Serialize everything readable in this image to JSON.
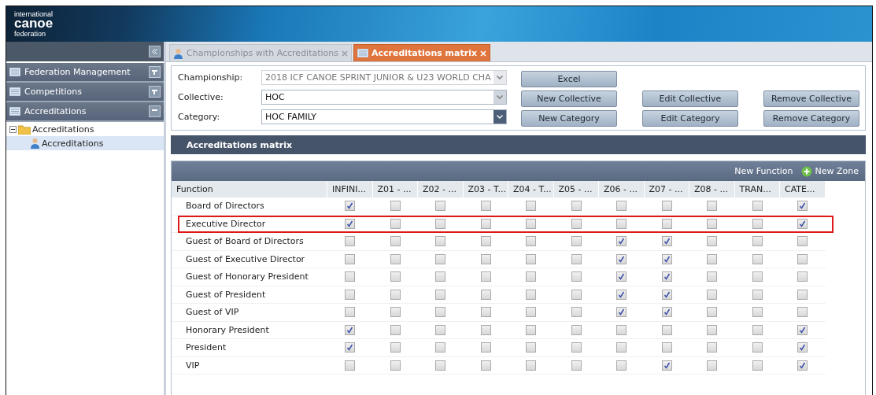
{
  "logo": [
    "international",
    "canoe",
    "federation"
  ],
  "sidebar": {
    "sections": [
      {
        "label": "Federation Management",
        "expanded": false
      },
      {
        "label": "Competitions",
        "expanded": false
      },
      {
        "label": "Accreditations",
        "expanded": true
      }
    ],
    "tree": [
      {
        "label": "Accreditations",
        "expanded": true,
        "selected": false,
        "children": [
          {
            "label": "Accreditations",
            "selected": true
          }
        ]
      }
    ]
  },
  "tabs": [
    {
      "label": "Championships with Accreditations",
      "selected": false
    },
    {
      "label": "Accreditations matrix",
      "selected": true
    }
  ],
  "form": {
    "fields": [
      {
        "label": "Championship:",
        "value": "2018 ICF CANOE SPRINT JUNIOR & U23 WORLD CHA",
        "disabled": true,
        "focused": false
      },
      {
        "label": "Collective:",
        "value": "HOC",
        "disabled": false,
        "focused": false
      },
      {
        "label": "Category:",
        "value": "HOC FAMILY",
        "disabled": false,
        "focused": true
      }
    ],
    "button_rows": [
      [
        "Excel"
      ],
      [
        "New Collective",
        "Edit Collective",
        "Remove Collective"
      ],
      [
        "New Category",
        "Edit Category",
        "Remove Category"
      ]
    ]
  },
  "matrix": {
    "title": "Accreditations matrix",
    "toolbar": [
      "New Function",
      "New Zone"
    ],
    "columns": [
      "Function",
      "INFINI...",
      "Z01 - ...",
      "Z02 - ...",
      "Z03 - T...",
      "Z04 - T...",
      "Z05 - ...",
      "Z06 - ...",
      "Z07 - ...",
      "Z08 - ...",
      "TRAN...",
      "CATE..."
    ],
    "rows": [
      {
        "function": "Board of Directors",
        "highlighted": false,
        "cells": [
          true,
          false,
          false,
          false,
          false,
          false,
          false,
          false,
          false,
          false,
          true
        ]
      },
      {
        "function": "Executive Director",
        "highlighted": true,
        "cells": [
          true,
          false,
          false,
          false,
          false,
          false,
          false,
          false,
          false,
          false,
          true
        ]
      },
      {
        "function": "Guest of Board of Directors",
        "highlighted": false,
        "cells": [
          false,
          false,
          false,
          false,
          false,
          false,
          true,
          true,
          false,
          false,
          false
        ]
      },
      {
        "function": "Guest of Executive Director",
        "highlighted": false,
        "cells": [
          false,
          false,
          false,
          false,
          false,
          false,
          true,
          true,
          false,
          false,
          false
        ]
      },
      {
        "function": "Guest of Honorary President",
        "highlighted": false,
        "cells": [
          false,
          false,
          false,
          false,
          false,
          false,
          true,
          true,
          false,
          false,
          false
        ]
      },
      {
        "function": "Guest of President",
        "highlighted": false,
        "cells": [
          false,
          false,
          false,
          false,
          false,
          false,
          true,
          true,
          false,
          false,
          false
        ]
      },
      {
        "function": "Guest of VIP",
        "highlighted": false,
        "cells": [
          false,
          false,
          false,
          false,
          false,
          false,
          true,
          true,
          false,
          false,
          false
        ]
      },
      {
        "function": "Honorary President",
        "highlighted": false,
        "cells": [
          true,
          false,
          false,
          false,
          false,
          false,
          false,
          false,
          false,
          false,
          true
        ]
      },
      {
        "function": "President",
        "highlighted": false,
        "cells": [
          true,
          false,
          false,
          false,
          false,
          false,
          false,
          false,
          false,
          false,
          true
        ]
      },
      {
        "function": "VIP",
        "highlighted": false,
        "cells": [
          false,
          false,
          false,
          false,
          false,
          false,
          false,
          true,
          false,
          false,
          true
        ]
      }
    ]
  }
}
